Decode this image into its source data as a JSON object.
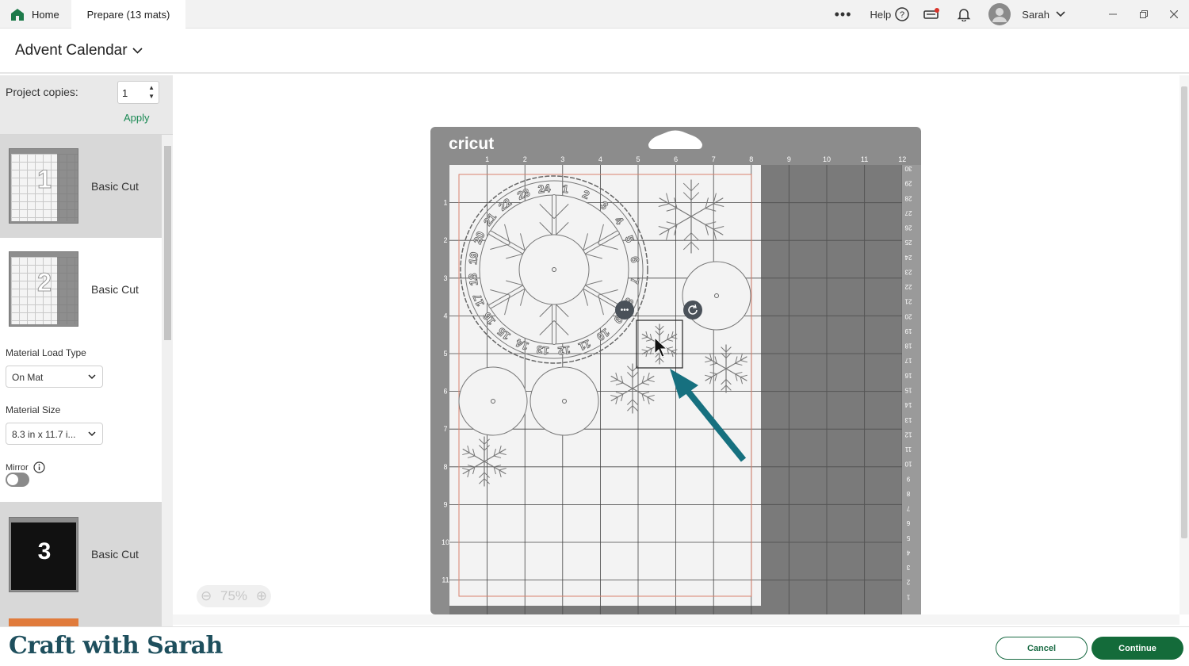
{
  "tabs": {
    "home": "Home",
    "prepare": "Prepare (13 mats)"
  },
  "top": {
    "help": "Help",
    "user": "Sarah"
  },
  "project": {
    "title": "Advent Calendar"
  },
  "sidebar": {
    "copies_label": "Project copies:",
    "copies_value": "1",
    "apply": "Apply",
    "mats": [
      {
        "number": "1",
        "label": "Basic Cut"
      },
      {
        "number": "2",
        "label": "Basic Cut"
      },
      {
        "number": "3",
        "label": "Basic Cut"
      }
    ],
    "load_type_label": "Material Load Type",
    "load_type_value": "On Mat",
    "size_label": "Material Size",
    "size_value": "8.3 in x 11.7 i...",
    "mirror_label": "Mirror"
  },
  "mat": {
    "brand": "cricut",
    "top_ruler": [
      "1",
      "2",
      "3",
      "4",
      "5",
      "6",
      "7",
      "8",
      "9",
      "10",
      "11",
      "12"
    ],
    "left_ruler": [
      "1",
      "2",
      "3",
      "4",
      "5",
      "6",
      "7",
      "8",
      "9",
      "10",
      "11"
    ],
    "right_ruler": [
      "30",
      "29",
      "28",
      "27",
      "26",
      "25",
      "24",
      "23",
      "22",
      "21",
      "20",
      "19",
      "18",
      "17",
      "16",
      "15",
      "14",
      "13",
      "12",
      "11",
      "10",
      "9",
      "8",
      "7",
      "6",
      "5",
      "4",
      "3",
      "2",
      "1"
    ],
    "ring_numbers": [
      "1",
      "2",
      "3",
      "4",
      "5",
      "6",
      "7",
      "8",
      "9",
      "10",
      "11",
      "12",
      "13",
      "14",
      "15",
      "16",
      "17",
      "18",
      "19",
      "20",
      "21",
      "22",
      "23",
      "24"
    ]
  },
  "zoom": {
    "value": "75%"
  },
  "footer": {
    "brand": "Craft with Sarah",
    "cancel": "Cancel",
    "continue": "Continue"
  },
  "colors": {
    "accent": "#146b3a",
    "arrow": "#16707f",
    "mat_gray": "#8c8c8c",
    "cut_line": "#d9826c"
  }
}
